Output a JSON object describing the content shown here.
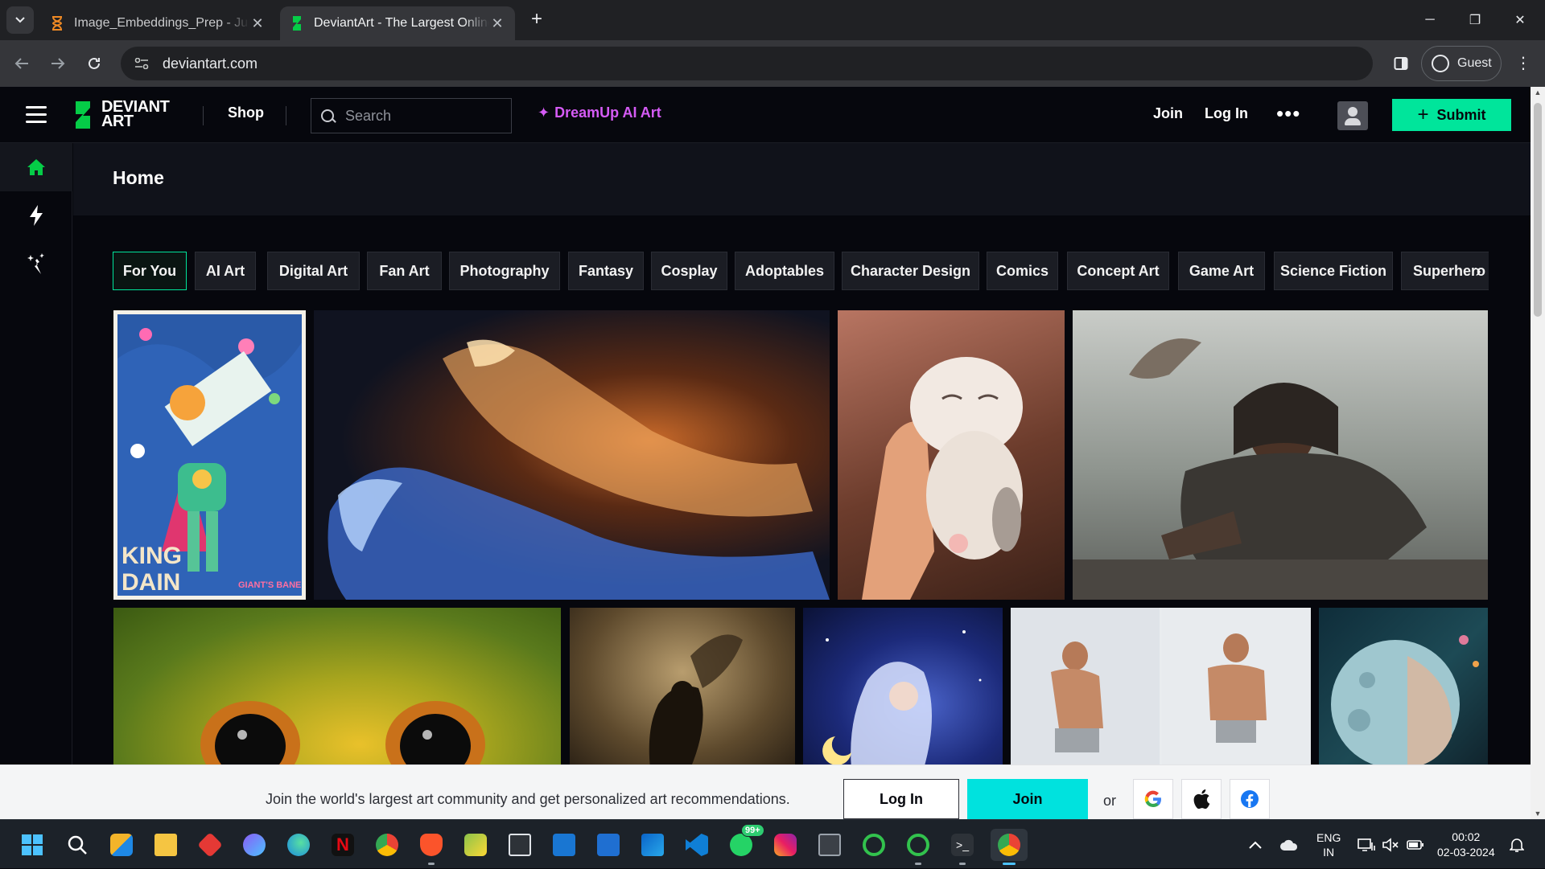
{
  "browser": {
    "tabs": [
      {
        "title": "Image_Embeddings_Prep - Jupy",
        "icon": "hourglass-icon",
        "active": false
      },
      {
        "title": "DeviantArt - The Largest Online",
        "icon": "deviantart-icon",
        "active": true
      }
    ],
    "new_tab": "+",
    "url": "deviantart.com",
    "profile_label": "Guest",
    "window_controls": {
      "minimize": "─",
      "restore": "❐",
      "close": "✕"
    }
  },
  "site": {
    "brand_line1": "DEVIANT",
    "brand_line2": "ART",
    "shop": "Shop",
    "search_placeholder": "Search",
    "dreamup": "DreamUp AI Art",
    "join": "Join",
    "login": "Log In",
    "more": "•••",
    "submit": "Submit",
    "accent_color": "#00e59b"
  },
  "rail": [
    {
      "name": "home",
      "icon": "home-icon",
      "active": true
    },
    {
      "name": "activity",
      "icon": "lightning-icon",
      "active": false
    },
    {
      "name": "dreamup",
      "icon": "sparkle-icon",
      "active": false
    }
  ],
  "home": {
    "title": "Home"
  },
  "chips": [
    "For You",
    "AI Art",
    "Digital Art",
    "Fan Art",
    "Photography",
    "Fantasy",
    "Cosplay",
    "Adoptables",
    "Character Design",
    "Comics",
    "Concept Art",
    "Game Art",
    "Science Fiction",
    "Superhero"
  ],
  "artworks": {
    "poster_text1": "KING",
    "poster_text2": "DAIN",
    "poster_text3": "GIANT'S BANE"
  },
  "join_banner": {
    "message": "Join the world's largest art community and get personalized art recommendations.",
    "login": "Log In",
    "join": "Join",
    "or": "or",
    "socials": [
      "google-icon",
      "apple-icon",
      "facebook-icon"
    ]
  },
  "taskbar": {
    "whatsapp_badge": "99+",
    "lang_line1": "ENG",
    "lang_line2": "IN",
    "time": "00:02",
    "date": "02-03-2024"
  }
}
